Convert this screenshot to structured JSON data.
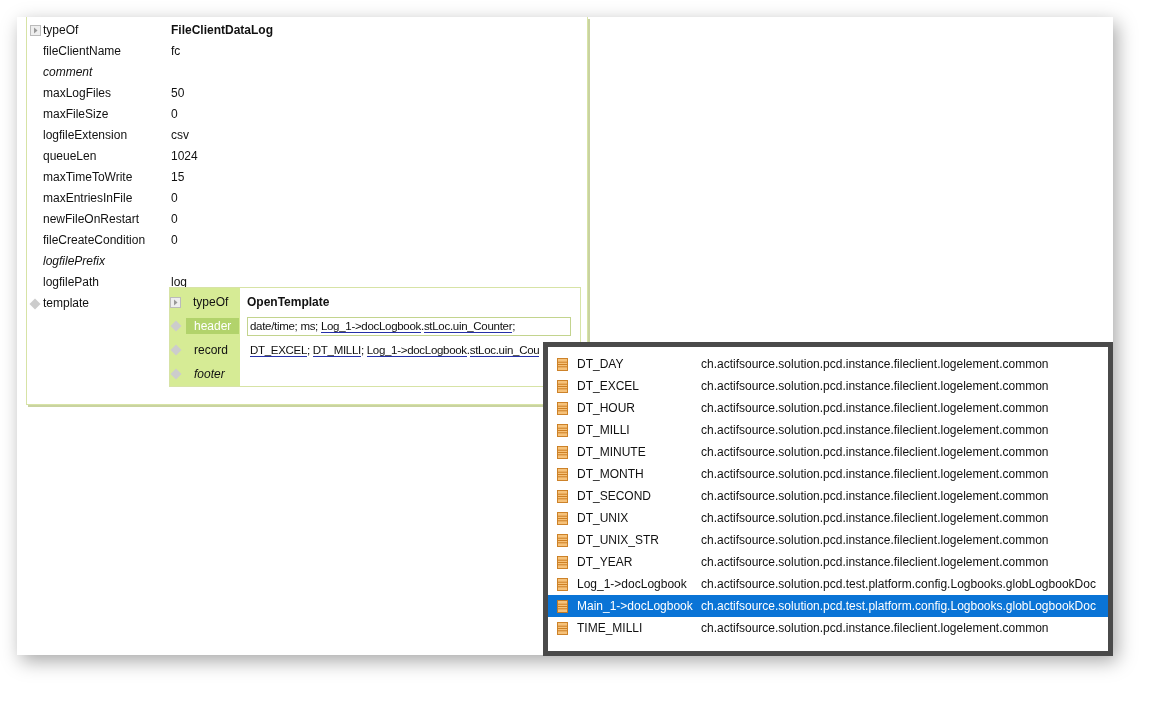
{
  "properties": [
    {
      "kind": "type",
      "name": "typeOf",
      "value": "FileClientDataLog",
      "optional": false
    },
    {
      "kind": "attribute",
      "name": "fileClientName",
      "value": "fc",
      "optional": false
    },
    {
      "kind": "attribute",
      "name": "comment",
      "optional": true
    },
    {
      "kind": "attribute",
      "name": "maxLogFiles",
      "value": "50",
      "optional": false
    },
    {
      "kind": "attribute",
      "name": "maxFileSize",
      "value": "0",
      "optional": false
    },
    {
      "kind": "attribute",
      "name": "logfileExtension",
      "value": "csv",
      "optional": false
    },
    {
      "kind": "attribute",
      "name": "queueLen",
      "value": "1024",
      "optional": false
    },
    {
      "kind": "attribute",
      "name": "maxTimeToWrite",
      "value": "15",
      "optional": false
    },
    {
      "kind": "attribute",
      "name": "maxEntriesInFile",
      "value": "0",
      "optional": false
    },
    {
      "kind": "attribute",
      "name": "newFileOnRestart",
      "value": "0",
      "optional": false
    },
    {
      "kind": "attribute",
      "name": "fileCreateCondition",
      "value": "0",
      "optional": false
    },
    {
      "kind": "attribute",
      "name": "logfilePrefix",
      "optional": true
    },
    {
      "kind": "attribute",
      "name": "logfilePath",
      "value": "log",
      "optional": false
    },
    {
      "kind": "template",
      "name": "template",
      "optional": false
    }
  ],
  "template": {
    "rows": [
      {
        "kind": "type",
        "name": "typeOf",
        "value": "OpenTemplate",
        "selected": false,
        "optional": false
      },
      {
        "kind": "expression",
        "name": "header",
        "selected": true,
        "optional": false,
        "segments": [
          {
            "text": "date/time; ms; ",
            "link": false
          },
          {
            "text": "Log_1->docLogbook",
            "link": true
          },
          {
            "text": ".",
            "link": false
          },
          {
            "text": "stLoc.uin_Counter",
            "link": true
          },
          {
            "text": ";",
            "link": false
          }
        ]
      },
      {
        "kind": "expression",
        "name": "record",
        "selected": false,
        "optional": false,
        "segments": [
          {
            "text": "DT_EXCEL",
            "link": true
          },
          {
            "text": "; ",
            "link": false
          },
          {
            "text": "DT_MILLI",
            "link": true
          },
          {
            "text": "; ",
            "link": false
          },
          {
            "text": "Log_1->docLogbook",
            "link": true
          },
          {
            "text": ".",
            "link": false
          },
          {
            "text": "stLoc.uin_Cou",
            "link": true
          }
        ]
      },
      {
        "kind": "expression",
        "name": "footer",
        "selected": false,
        "optional": true,
        "segments": []
      }
    ]
  },
  "completions": [
    {
      "name": "DT_DAY",
      "package": "ch.actifsource.solution.pcd.instance.fileclient.logelement.common",
      "selected": false
    },
    {
      "name": "DT_EXCEL",
      "package": "ch.actifsource.solution.pcd.instance.fileclient.logelement.common",
      "selected": false
    },
    {
      "name": "DT_HOUR",
      "package": "ch.actifsource.solution.pcd.instance.fileclient.logelement.common",
      "selected": false
    },
    {
      "name": "DT_MILLI",
      "package": "ch.actifsource.solution.pcd.instance.fileclient.logelement.common",
      "selected": false
    },
    {
      "name": "DT_MINUTE",
      "package": "ch.actifsource.solution.pcd.instance.fileclient.logelement.common",
      "selected": false
    },
    {
      "name": "DT_MONTH",
      "package": "ch.actifsource.solution.pcd.instance.fileclient.logelement.common",
      "selected": false
    },
    {
      "name": "DT_SECOND",
      "package": "ch.actifsource.solution.pcd.instance.fileclient.logelement.common",
      "selected": false
    },
    {
      "name": "DT_UNIX",
      "package": "ch.actifsource.solution.pcd.instance.fileclient.logelement.common",
      "selected": false
    },
    {
      "name": "DT_UNIX_STR",
      "package": "ch.actifsource.solution.pcd.instance.fileclient.logelement.common",
      "selected": false
    },
    {
      "name": "DT_YEAR",
      "package": "ch.actifsource.solution.pcd.instance.fileclient.logelement.common",
      "selected": false
    },
    {
      "name": "Log_1->docLogbook",
      "package": "ch.actifsource.solution.pcd.test.platform.config.Logbooks.globLogbookDoc",
      "selected": false
    },
    {
      "name": "Main_1->docLogbook",
      "package": "ch.actifsource.solution.pcd.test.platform.config.Logbooks.globLogbookDoc",
      "selected": true
    },
    {
      "name": "TIME_MILLI",
      "package": "ch.actifsource.solution.pcd.instance.fileclient.logelement.common",
      "selected": false
    }
  ]
}
